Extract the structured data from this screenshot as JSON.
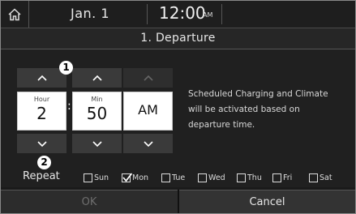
{
  "header": {
    "date": "Jan. 1",
    "time": "12:00",
    "time_suffix": "AM"
  },
  "title": "1. Departure",
  "picker": {
    "hour": {
      "label": "Hour",
      "value": "2"
    },
    "colon": ":",
    "minute": {
      "label": "Min",
      "value": "50"
    },
    "period": {
      "value": "AM"
    }
  },
  "callouts": {
    "one": "1",
    "two": "2"
  },
  "info_text": "Scheduled Charging and Climate will be activated based on departure time.",
  "repeat": {
    "label": "Repeat",
    "days": [
      {
        "label": "Sun",
        "checked": false
      },
      {
        "label": "Mon",
        "checked": true
      },
      {
        "label": "Tue",
        "checked": false
      },
      {
        "label": "Wed",
        "checked": false
      },
      {
        "label": "Thu",
        "checked": false
      },
      {
        "label": "Fri",
        "checked": false
      },
      {
        "label": "Sat",
        "checked": false
      }
    ]
  },
  "buttons": {
    "ok": "OK",
    "cancel": "Cancel"
  },
  "colors": {
    "background": "#1a1a1a",
    "value_box": "#ffffff",
    "arrow_button": "#3a3a3a"
  }
}
